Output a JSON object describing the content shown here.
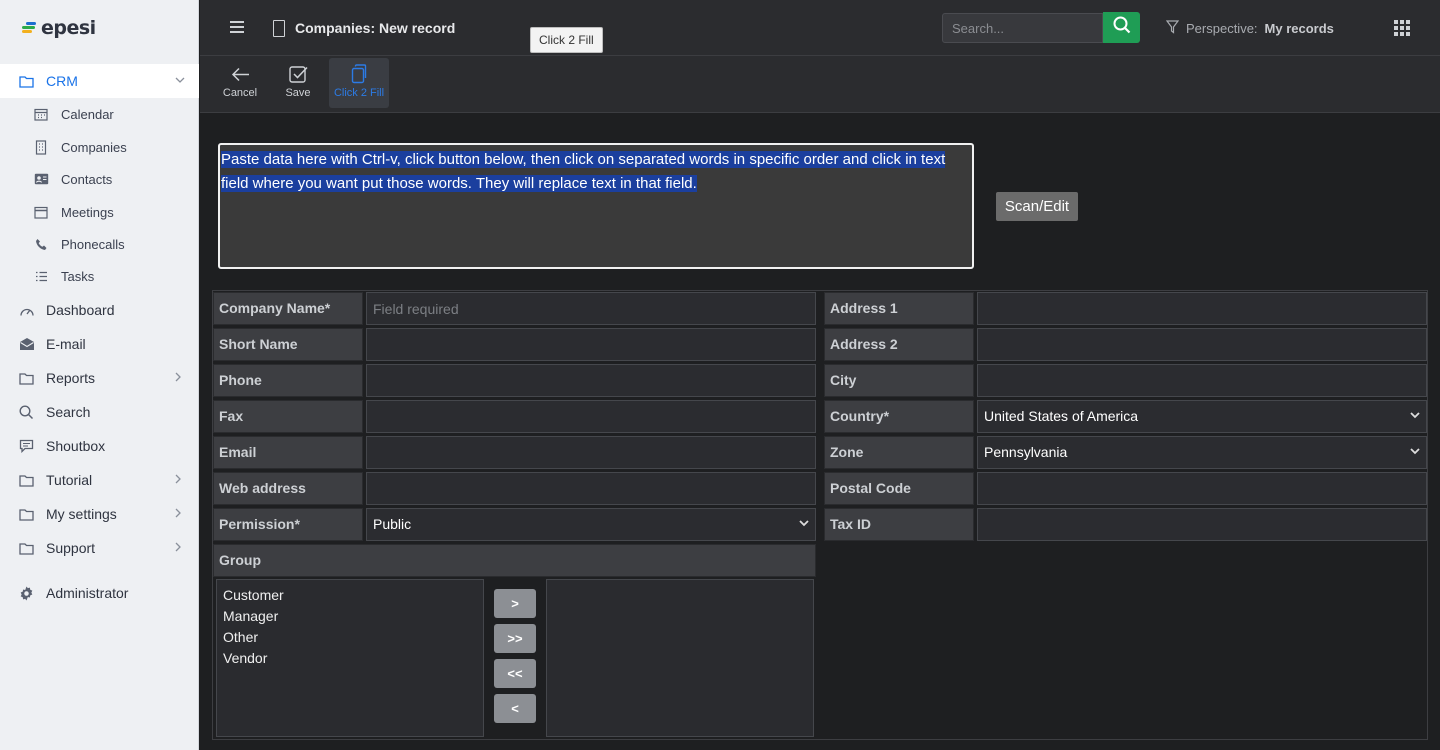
{
  "app": {
    "logo_text": "epesi"
  },
  "sidebar": {
    "items": [
      {
        "label": "CRM",
        "icon": "folder-icon",
        "active": true,
        "chevron": true
      },
      {
        "label": "Dashboard",
        "icon": "dashboard-icon"
      },
      {
        "label": "E-mail",
        "icon": "email-icon"
      },
      {
        "label": "Reports",
        "icon": "folder-icon",
        "chevron": true
      },
      {
        "label": "Search",
        "icon": "search-icon"
      },
      {
        "label": "Shoutbox",
        "icon": "chat-icon"
      },
      {
        "label": "Tutorial",
        "icon": "folder-icon",
        "chevron": true
      },
      {
        "label": "My settings",
        "icon": "folder-icon",
        "chevron": true
      },
      {
        "label": "Support",
        "icon": "folder-icon",
        "chevron": true
      },
      {
        "label": "Administrator",
        "icon": "gear-icon"
      }
    ],
    "crm_sub": [
      {
        "label": "Calendar",
        "icon": "calendar-icon"
      },
      {
        "label": "Companies",
        "icon": "building-icon"
      },
      {
        "label": "Contacts",
        "icon": "contact-card-icon"
      },
      {
        "label": "Meetings",
        "icon": "meeting-icon"
      },
      {
        "label": "Phonecalls",
        "icon": "phone-icon"
      },
      {
        "label": "Tasks",
        "icon": "list-icon"
      }
    ]
  },
  "header": {
    "title": "Companies: New record",
    "search_placeholder": "Search...",
    "perspective_label": "Perspective:",
    "perspective_value": "My records",
    "tooltip": "Click 2 Fill"
  },
  "toolbar": {
    "cancel": "Cancel",
    "save": "Save",
    "click2fill": "Click 2 Fill"
  },
  "paste": {
    "text": "Paste data here with Ctrl-v, click button below, then click on separated words in specific order and click in text field where you want put those words. They will replace text in that field.",
    "scan_button": "Scan/Edit"
  },
  "form": {
    "left": [
      {
        "label": "Company Name*",
        "placeholder": "Field required",
        "value": ""
      },
      {
        "label": "Short Name",
        "value": ""
      },
      {
        "label": "Phone",
        "value": ""
      },
      {
        "label": "Fax",
        "value": ""
      },
      {
        "label": "Email",
        "value": ""
      },
      {
        "label": "Web address",
        "value": ""
      },
      {
        "label": "Permission*",
        "value": "Public",
        "select": true
      }
    ],
    "right": [
      {
        "label": "Address 1",
        "value": ""
      },
      {
        "label": "Address 2",
        "value": ""
      },
      {
        "label": "City",
        "value": ""
      },
      {
        "label": "Country*",
        "value": "United States of America",
        "select": true
      },
      {
        "label": "Zone",
        "value": "Pennsylvania",
        "select": true
      },
      {
        "label": "Postal Code",
        "value": ""
      },
      {
        "label": "Tax ID",
        "value": ""
      }
    ],
    "group_label": "Group",
    "group_options": [
      "Customer",
      "Manager",
      "Other",
      "Vendor"
    ],
    "move_buttons": [
      ">",
      ">>",
      "<<",
      "<"
    ]
  }
}
